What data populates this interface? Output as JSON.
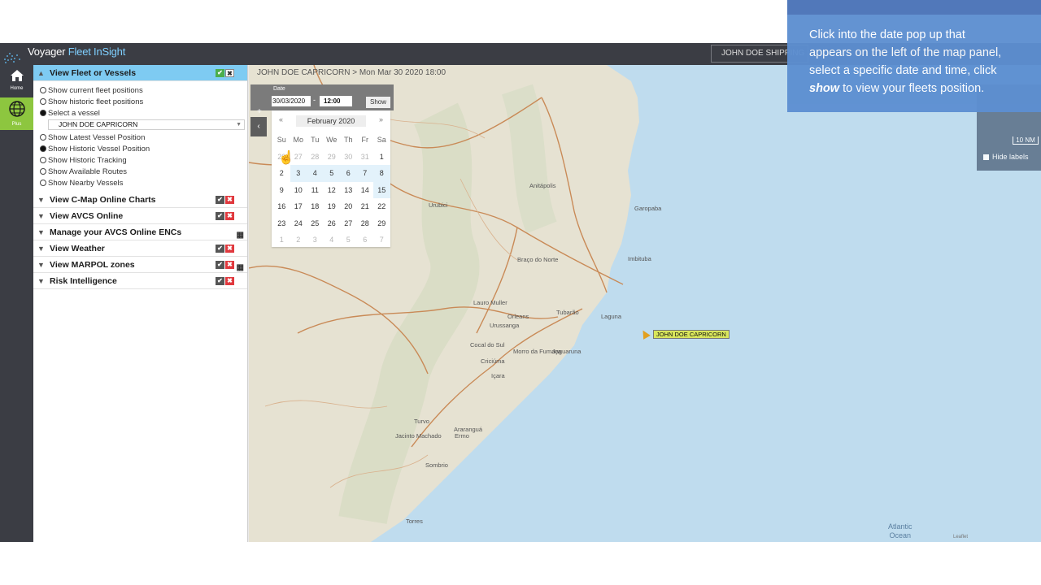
{
  "app": {
    "brand_part1": "Voyager",
    "brand_part2": "Fleet InSight",
    "company_button": "JOHN DOE SHIPPING",
    "nav": {
      "home_label": "Home",
      "plus_label": "Plus"
    }
  },
  "breadcrumb": "JOHN DOE CAPRICORN > Mon Mar 30 2020 18:00",
  "panel": {
    "sections": [
      {
        "label": "View Fleet or Vessels",
        "expanded": true
      },
      {
        "label": "View C-Map Online Charts"
      },
      {
        "label": "View AVCS Online"
      },
      {
        "label": "Manage your AVCS Online ENCs"
      },
      {
        "label": "View Weather"
      },
      {
        "label": "View MARPOL zones"
      },
      {
        "label": "Risk Intelligence"
      }
    ],
    "options": [
      "Show current fleet positions",
      "Show historic fleet positions",
      "Select a vessel",
      "Show Latest Vessel Position",
      "Show Historic Vessel Position",
      "Show Historic Tracking",
      "Show Available Routes",
      "Show Nearby Vessels"
    ],
    "selected_vessel": "JOHN DOE CAPRICORN"
  },
  "date_filter": {
    "label": "Date",
    "date_value": "30/03/2020",
    "dash": "-",
    "time_value": "12:00",
    "show_button": "Show",
    "plus": "+",
    "collapse": "‹"
  },
  "calendar": {
    "prev": "«",
    "next": "»",
    "month": "February 2020",
    "dow": [
      "Su",
      "Mo",
      "Tu",
      "We",
      "Th",
      "Fr",
      "Sa"
    ],
    "weeks": [
      [
        "26",
        "27",
        "28",
        "29",
        "30",
        "31",
        "1"
      ],
      [
        "2",
        "3",
        "4",
        "5",
        "6",
        "7",
        "8"
      ],
      [
        "9",
        "10",
        "11",
        "12",
        "13",
        "14",
        "15"
      ],
      [
        "16",
        "17",
        "18",
        "19",
        "20",
        "21",
        "22"
      ],
      [
        "23",
        "24",
        "25",
        "26",
        "27",
        "28",
        "29"
      ],
      [
        "1",
        "2",
        "3",
        "4",
        "5",
        "6",
        "7"
      ]
    ]
  },
  "map": {
    "vessel_label": "JOHN DOE CAPRICORN",
    "places": [
      "Anitápolis",
      "Urubici",
      "Garopaba",
      "Imbituba",
      "Braço do Norte",
      "Lauro Muller",
      "Tubarão",
      "Laguna",
      "Orleans",
      "Urussanga",
      "Cocal do Sul",
      "Criciúma",
      "Morro da Fumaça",
      "Jaguaruna",
      "Içara",
      "Turvo",
      "Araranguá",
      "Ermo",
      "Jacinto Machado",
      "Sombrio",
      "Torres"
    ],
    "ocean_line1": "Atlantic",
    "ocean_line2": "Ocean",
    "scale": "10 NM",
    "hide_labels": "Hide labels",
    "attribution": "Leaflet"
  },
  "tip": {
    "line1": "Click into the date pop up that",
    "line2": "appears on the left of the map panel,",
    "line3": "select a specific date and time, click",
    "emph": "show",
    "line4_rest": " to view your fleets position."
  },
  "colors": {
    "accent": "#7ecbf2",
    "plus_nav": "#8dc63f",
    "tip_bg": "#5d8fd1",
    "vessel_label": "#d9e65c"
  }
}
